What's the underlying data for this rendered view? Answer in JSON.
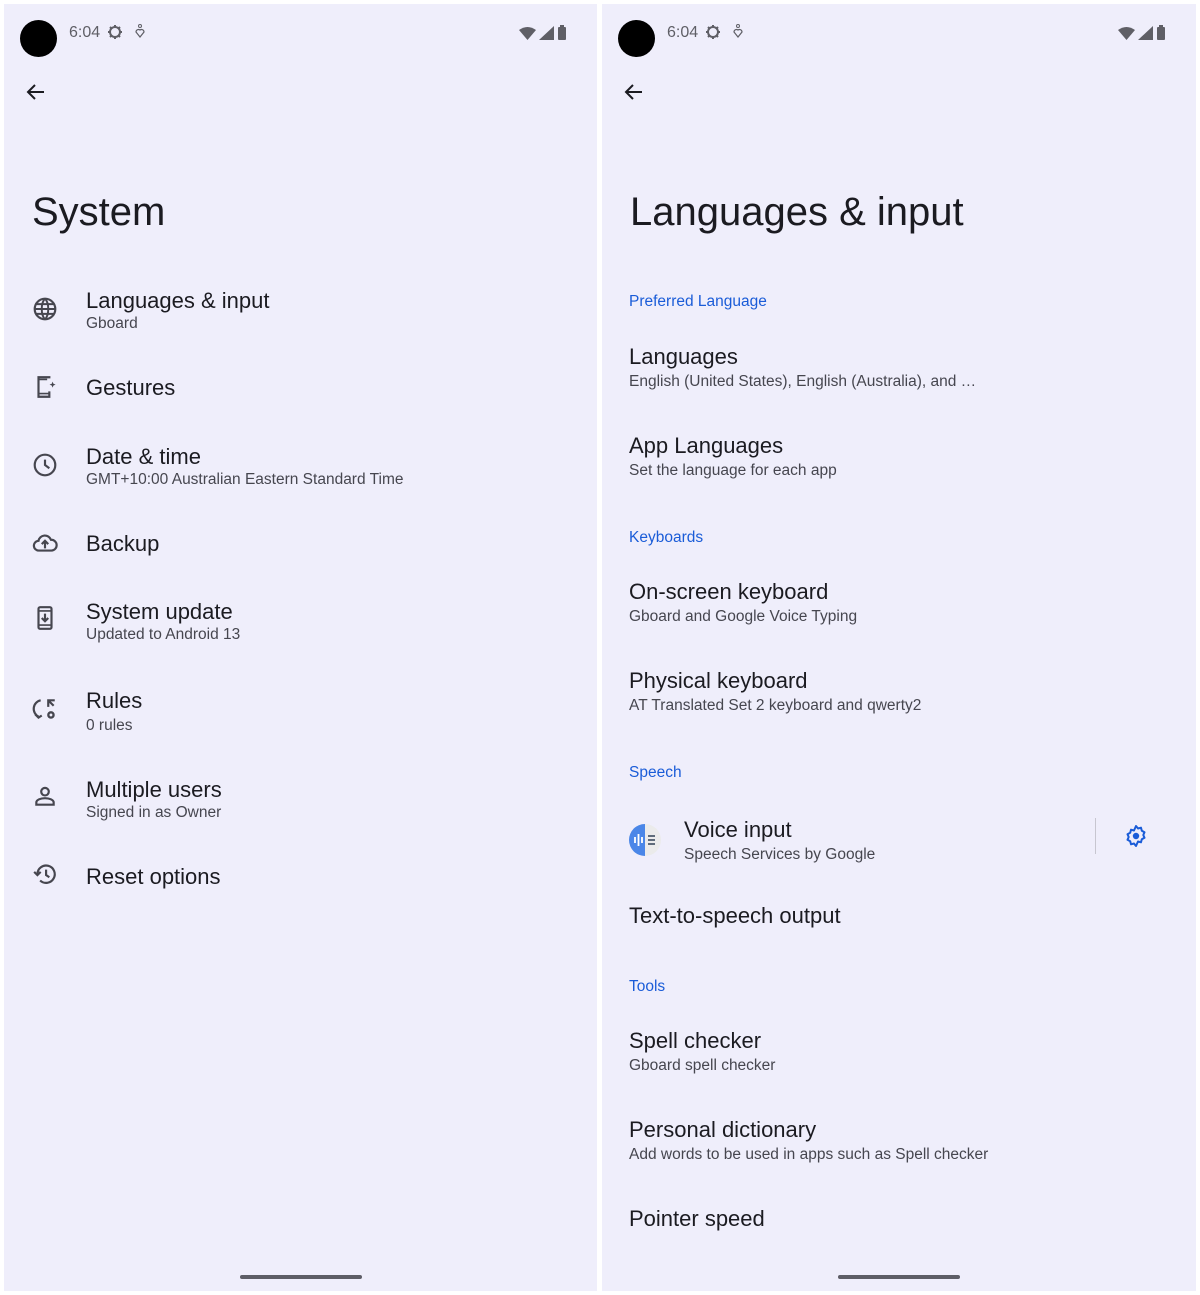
{
  "status_bar": {
    "time": "6:04",
    "icons": [
      "settings-gear-icon",
      "location-pin-icon",
      "wifi-icon",
      "cell-signal-icon",
      "battery-icon"
    ]
  },
  "left": {
    "back_icon": "arrow-back-icon",
    "title": "System",
    "items": [
      {
        "title": "Languages & input",
        "subtitle": "Gboard",
        "icon": "globe-icon"
      },
      {
        "title": "Gestures",
        "subtitle": "",
        "icon": "phone-gestures-icon"
      },
      {
        "title": "Date & time",
        "subtitle": "GMT+10:00 Australian Eastern Standard Time",
        "icon": "clock-icon"
      },
      {
        "title": "Backup",
        "subtitle": "",
        "icon": "cloud-upload-icon"
      },
      {
        "title": "System update",
        "subtitle": "Updated to Android 13",
        "icon": "system-update-icon"
      },
      {
        "title": "Rules",
        "subtitle": "0 rules",
        "icon": "rules-icon"
      },
      {
        "title": "Multiple users",
        "subtitle": "Signed in as Owner",
        "icon": "person-icon"
      },
      {
        "title": "Reset options",
        "subtitle": "",
        "icon": "history-icon"
      }
    ]
  },
  "right": {
    "back_icon": "arrow-back-icon",
    "title": "Languages & input",
    "categories": {
      "preferred_language": "Preferred Language",
      "keyboards": "Keyboards",
      "speech": "Speech",
      "tools": "Tools"
    },
    "items": {
      "languages": {
        "title": "Languages",
        "subtitle": "English (United States), English (Australia), and …"
      },
      "app_languages": {
        "title": "App Languages",
        "subtitle": "Set the language for each app"
      },
      "onscreen_keyboard": {
        "title": "On-screen keyboard",
        "subtitle": "Gboard and Google Voice Typing"
      },
      "physical_keyboard": {
        "title": "Physical keyboard",
        "subtitle": "AT Translated Set 2 keyboard and qwerty2"
      },
      "voice_input": {
        "title": "Voice input",
        "subtitle": "Speech Services by Google"
      },
      "tts_output": {
        "title": "Text-to-speech output",
        "subtitle": ""
      },
      "spell_checker": {
        "title": "Spell checker",
        "subtitle": "Gboard spell checker"
      },
      "personal_dictionary": {
        "title": "Personal dictionary",
        "subtitle": "Add words to be used in apps such as Spell checker"
      },
      "pointer_speed": {
        "title": "Pointer speed",
        "subtitle": ""
      }
    }
  },
  "colors": {
    "background": "#efeefb",
    "accent": "#1a5cd8",
    "text": "#1b1b21",
    "subtext": "#46464f"
  }
}
